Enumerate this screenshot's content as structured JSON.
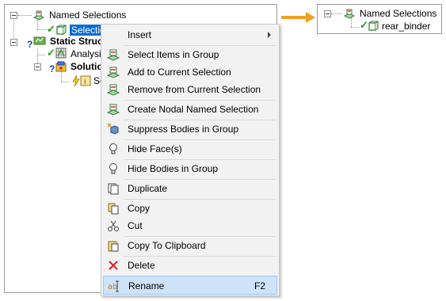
{
  "left_tree": {
    "named_selections": "Named Selections",
    "selection_item": "Selection",
    "static_structural": "Static Struc",
    "analysis_settings": "Analysis",
    "solution": "Solution",
    "solution_child": "So"
  },
  "right_tree": {
    "named_selections": "Named Selections",
    "child": "rear_binder"
  },
  "context_menu": {
    "insert": "Insert",
    "select_items_in_group": "Select Items in Group",
    "add_to_current_selection": "Add to Current Selection",
    "remove_from_current_selection": "Remove from Current Selection",
    "create_nodal_named_selection": "Create Nodal Named Selection",
    "suppress_bodies_in_group": "Suppress Bodies in Group",
    "hide_faces": "Hide Face(s)",
    "hide_bodies_in_group": "Hide Bodies in Group",
    "duplicate": "Duplicate",
    "copy": "Copy",
    "cut": "Cut",
    "copy_to_clipboard": "Copy To Clipboard",
    "delete": "Delete",
    "rename": "Rename",
    "rename_shortcut": "F2"
  },
  "colors": {
    "arrow": "#f0a020",
    "selection": "#0a6bd1",
    "menu_highlight": "#cde3f7"
  }
}
